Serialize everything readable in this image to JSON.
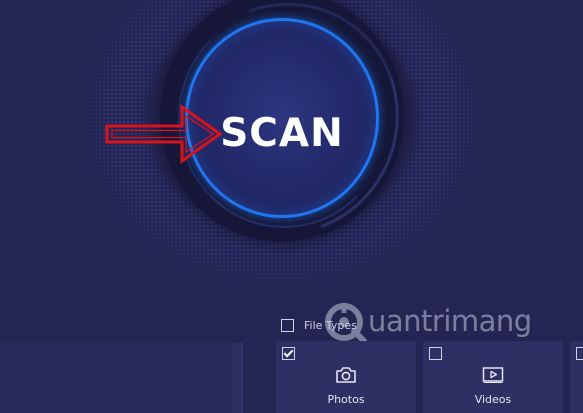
{
  "scan_button": {
    "label": "SCAN"
  },
  "file_types": {
    "label": "File Types",
    "checked": false
  },
  "type_cards": [
    {
      "label": "Photos",
      "checked": true,
      "icon": "camera-icon"
    },
    {
      "label": "Videos",
      "checked": false,
      "icon": "video-play-icon"
    }
  ],
  "watermark": {
    "text": "uantrimang"
  },
  "colors": {
    "background": "#252554",
    "scan_ring": "#1f76f0",
    "arrow": "#d9121b",
    "card": "#2e2f62",
    "text": "#ffffff"
  }
}
